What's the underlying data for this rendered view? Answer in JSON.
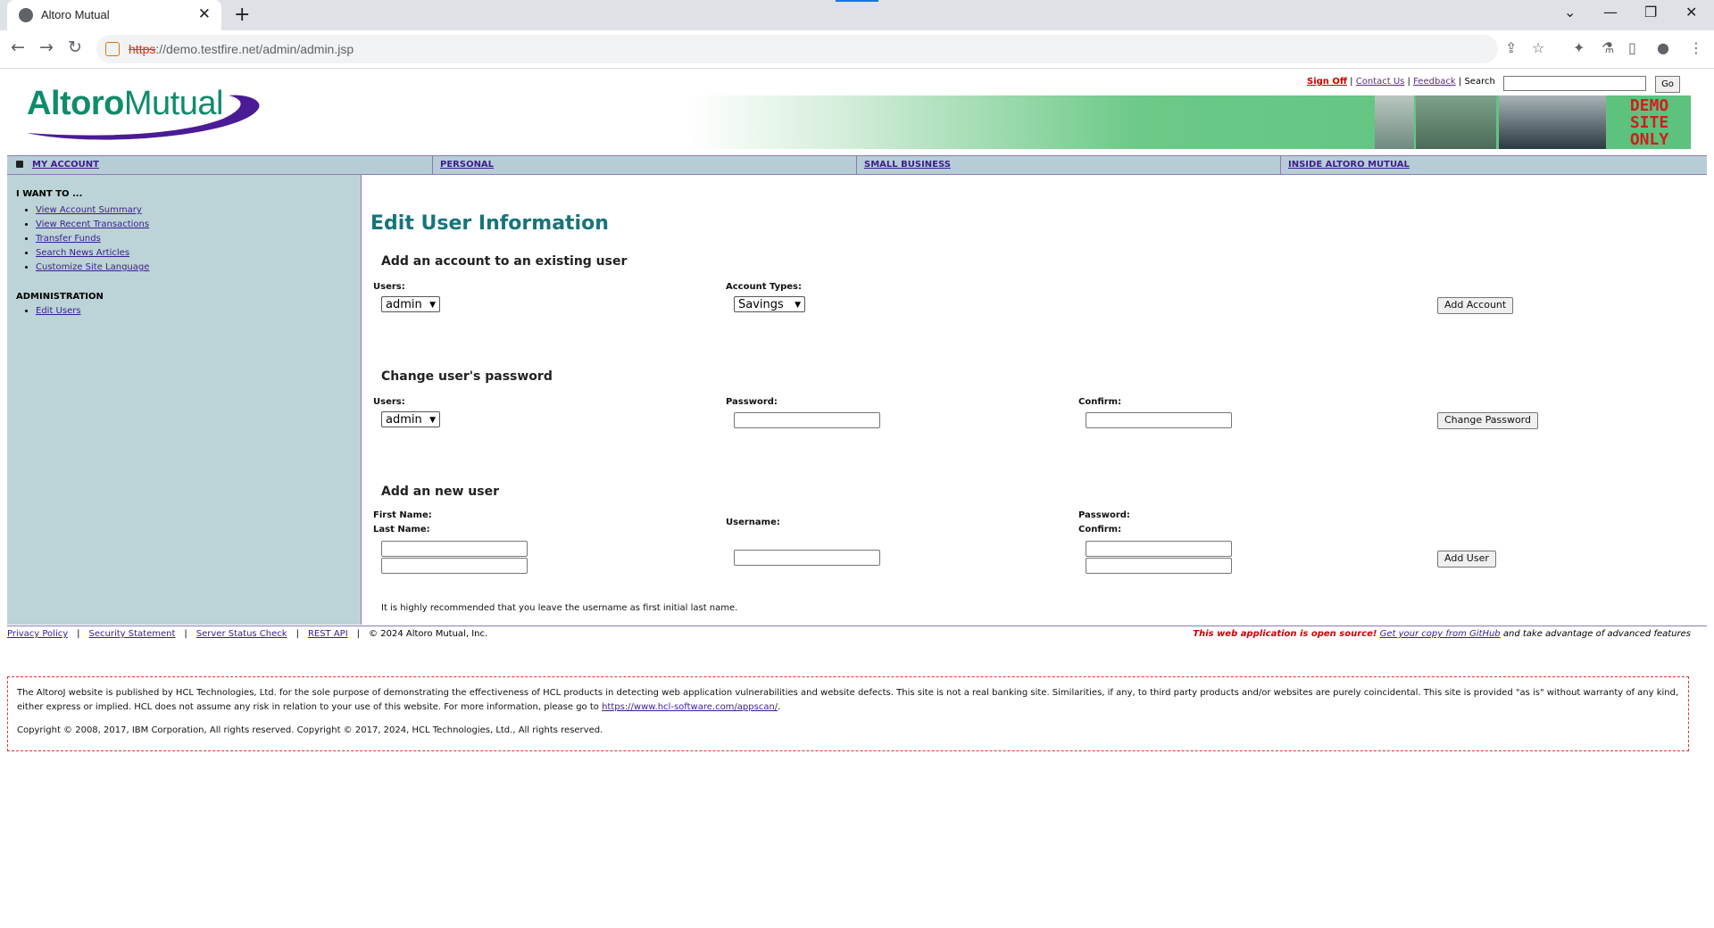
{
  "browser": {
    "tab_title": "Altoro Mutual",
    "tab_close": "✕",
    "new_tab": "+",
    "url_scheme": "https",
    "url_rest": "://demo.testfire.net/admin/admin.jsp",
    "win_min": "—",
    "win_restore": "❐",
    "win_close": "✕",
    "tab_list": "⌄"
  },
  "header": {
    "logo_part1": "Altoro",
    "logo_part2": "Mutual",
    "sign_off": "Sign Off",
    "contact_us": "Contact Us",
    "feedback": "Feedback",
    "search_label": "Search",
    "go_button": "Go",
    "demo_line1": "DEMO",
    "demo_line2": "SITE",
    "demo_line3": "ONLY"
  },
  "nav": {
    "my_account": "MY ACCOUNT",
    "personal": "PERSONAL",
    "small_business": "SMALL BUSINESS",
    "inside": "INSIDE ALTORO MUTUAL"
  },
  "sidebar": {
    "i_want_to": "I WANT TO ...",
    "links": [
      "View Account Summary",
      "View Recent Transactions",
      "Transfer Funds",
      "Search News Articles",
      "Customize Site Language"
    ],
    "admin_heading": "ADMINISTRATION",
    "admin_links": [
      "Edit Users"
    ]
  },
  "main": {
    "title": "Edit User Information",
    "add_account": {
      "heading": "Add an account to an existing user",
      "users_label": "Users:",
      "users_value": "admin",
      "types_label": "Account Types:",
      "types_value": "Savings",
      "button": "Add Account"
    },
    "change_password": {
      "heading": "Change user's password",
      "users_label": "Users:",
      "users_value": "admin",
      "password_label": "Password:",
      "confirm_label": "Confirm:",
      "button": "Change Password"
    },
    "new_user": {
      "heading": "Add an new user",
      "first_name_label": "First Name:",
      "last_name_label": "Last Name:",
      "username_label": "Username:",
      "password_label": "Password:",
      "confirm_label": "Confirm:",
      "button": "Add User",
      "note": "It is highly recommended that you leave the username as first initial last name."
    }
  },
  "footer": {
    "privacy": "Privacy Policy",
    "security": "Security Statement",
    "server_status": "Server Status Check",
    "rest_api": "REST API",
    "sep": "|",
    "copyright": "© 2024 Altoro Mutual, Inc.",
    "open_source": "This web application is open source!",
    "get_copy": "Get your copy from GitHub",
    "advantage": "and take advantage of advanced features",
    "disclaimer_text": "The AltoroJ website is published by HCL Technologies, Ltd. for the sole purpose of demonstrating the effectiveness of HCL products in detecting web application vulnerabilities and website defects. This site is not a real banking site. Similarities, if any, to third party products and/or websites are purely coincidental. This site is provided \"as is\" without warranty of any kind, either express or implied. HCL does not assume any risk in relation to your use of this website. For more information, please go to",
    "disclaimer_link": "https://www.hcl-software.com/appscan/",
    "disclaimer_end": ".",
    "copyright_full": "Copyright © 2008, 2017, IBM Corporation, All rights reserved. Copyright © 2017, 2024, HCL Technologies, Ltd., All rights reserved."
  }
}
